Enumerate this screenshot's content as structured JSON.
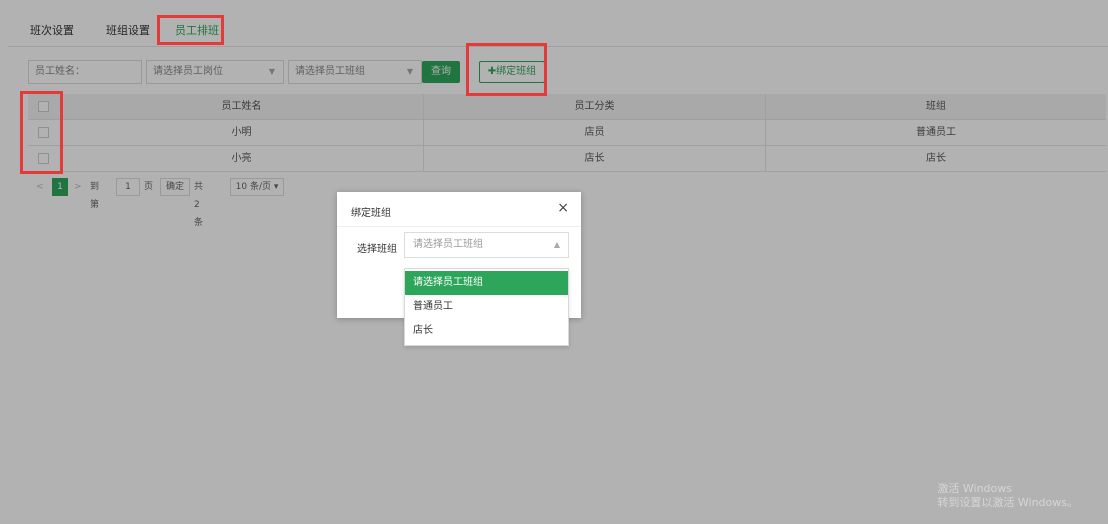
{
  "tabs": [
    "班次设置",
    "班组设置",
    "员工排班"
  ],
  "filters": {
    "name_label": "员工姓名：",
    "position_placeholder": "请选择员工岗位",
    "group_placeholder": "请选择员工班组",
    "query_button": "查询",
    "bind_button": "✚绑定班组"
  },
  "table": {
    "headers": [
      "员工姓名",
      "员工分类",
      "班组"
    ],
    "rows": [
      [
        "小明",
        "店员",
        "普通员工"
      ],
      [
        "小亮",
        "店长",
        "店长"
      ]
    ]
  },
  "pager": {
    "prev": "<",
    "current": "1",
    "next": ">",
    "goto_label": "到第",
    "page_input": "1",
    "page_unit": "页",
    "confirm": "确定",
    "total": "共 2 条",
    "page_size": "10 条/页 ▾"
  },
  "modal": {
    "title": "绑定班组",
    "close": "×",
    "label": "选择班组",
    "select_placeholder": "请选择员工班组",
    "caret": "▲",
    "options": [
      "请选择员工班组",
      "普通员工",
      "店长"
    ]
  },
  "watermark": {
    "line1": "激活 Windows",
    "line2": "转到设置以激活 Windows。"
  },
  "colors": {
    "accent": "#2da65c",
    "highlight": "#e53a3a"
  }
}
